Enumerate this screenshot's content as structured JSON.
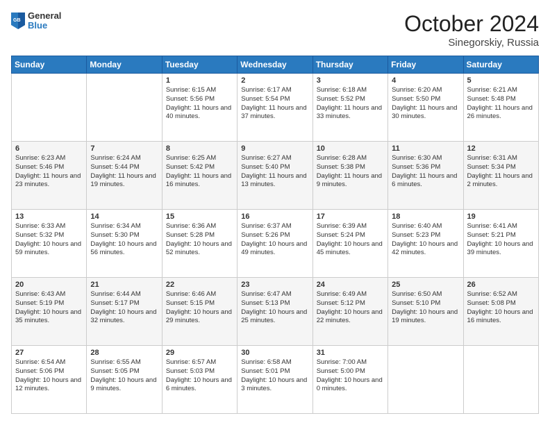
{
  "header": {
    "logo_line1": "General",
    "logo_line2": "Blue",
    "month": "October 2024",
    "location": "Sinegorskiy, Russia"
  },
  "days_of_week": [
    "Sunday",
    "Monday",
    "Tuesday",
    "Wednesday",
    "Thursday",
    "Friday",
    "Saturday"
  ],
  "weeks": [
    [
      {
        "day": "",
        "content": ""
      },
      {
        "day": "",
        "content": ""
      },
      {
        "day": "1",
        "content": "Sunrise: 6:15 AM\nSunset: 5:56 PM\nDaylight: 11 hours and 40 minutes."
      },
      {
        "day": "2",
        "content": "Sunrise: 6:17 AM\nSunset: 5:54 PM\nDaylight: 11 hours and 37 minutes."
      },
      {
        "day": "3",
        "content": "Sunrise: 6:18 AM\nSunset: 5:52 PM\nDaylight: 11 hours and 33 minutes."
      },
      {
        "day": "4",
        "content": "Sunrise: 6:20 AM\nSunset: 5:50 PM\nDaylight: 11 hours and 30 minutes."
      },
      {
        "day": "5",
        "content": "Sunrise: 6:21 AM\nSunset: 5:48 PM\nDaylight: 11 hours and 26 minutes."
      }
    ],
    [
      {
        "day": "6",
        "content": "Sunrise: 6:23 AM\nSunset: 5:46 PM\nDaylight: 11 hours and 23 minutes."
      },
      {
        "day": "7",
        "content": "Sunrise: 6:24 AM\nSunset: 5:44 PM\nDaylight: 11 hours and 19 minutes."
      },
      {
        "day": "8",
        "content": "Sunrise: 6:25 AM\nSunset: 5:42 PM\nDaylight: 11 hours and 16 minutes."
      },
      {
        "day": "9",
        "content": "Sunrise: 6:27 AM\nSunset: 5:40 PM\nDaylight: 11 hours and 13 minutes."
      },
      {
        "day": "10",
        "content": "Sunrise: 6:28 AM\nSunset: 5:38 PM\nDaylight: 11 hours and 9 minutes."
      },
      {
        "day": "11",
        "content": "Sunrise: 6:30 AM\nSunset: 5:36 PM\nDaylight: 11 hours and 6 minutes."
      },
      {
        "day": "12",
        "content": "Sunrise: 6:31 AM\nSunset: 5:34 PM\nDaylight: 11 hours and 2 minutes."
      }
    ],
    [
      {
        "day": "13",
        "content": "Sunrise: 6:33 AM\nSunset: 5:32 PM\nDaylight: 10 hours and 59 minutes."
      },
      {
        "day": "14",
        "content": "Sunrise: 6:34 AM\nSunset: 5:30 PM\nDaylight: 10 hours and 56 minutes."
      },
      {
        "day": "15",
        "content": "Sunrise: 6:36 AM\nSunset: 5:28 PM\nDaylight: 10 hours and 52 minutes."
      },
      {
        "day": "16",
        "content": "Sunrise: 6:37 AM\nSunset: 5:26 PM\nDaylight: 10 hours and 49 minutes."
      },
      {
        "day": "17",
        "content": "Sunrise: 6:39 AM\nSunset: 5:24 PM\nDaylight: 10 hours and 45 minutes."
      },
      {
        "day": "18",
        "content": "Sunrise: 6:40 AM\nSunset: 5:23 PM\nDaylight: 10 hours and 42 minutes."
      },
      {
        "day": "19",
        "content": "Sunrise: 6:41 AM\nSunset: 5:21 PM\nDaylight: 10 hours and 39 minutes."
      }
    ],
    [
      {
        "day": "20",
        "content": "Sunrise: 6:43 AM\nSunset: 5:19 PM\nDaylight: 10 hours and 35 minutes."
      },
      {
        "day": "21",
        "content": "Sunrise: 6:44 AM\nSunset: 5:17 PM\nDaylight: 10 hours and 32 minutes."
      },
      {
        "day": "22",
        "content": "Sunrise: 6:46 AM\nSunset: 5:15 PM\nDaylight: 10 hours and 29 minutes."
      },
      {
        "day": "23",
        "content": "Sunrise: 6:47 AM\nSunset: 5:13 PM\nDaylight: 10 hours and 25 minutes."
      },
      {
        "day": "24",
        "content": "Sunrise: 6:49 AM\nSunset: 5:12 PM\nDaylight: 10 hours and 22 minutes."
      },
      {
        "day": "25",
        "content": "Sunrise: 6:50 AM\nSunset: 5:10 PM\nDaylight: 10 hours and 19 minutes."
      },
      {
        "day": "26",
        "content": "Sunrise: 6:52 AM\nSunset: 5:08 PM\nDaylight: 10 hours and 16 minutes."
      }
    ],
    [
      {
        "day": "27",
        "content": "Sunrise: 6:54 AM\nSunset: 5:06 PM\nDaylight: 10 hours and 12 minutes."
      },
      {
        "day": "28",
        "content": "Sunrise: 6:55 AM\nSunset: 5:05 PM\nDaylight: 10 hours and 9 minutes."
      },
      {
        "day": "29",
        "content": "Sunrise: 6:57 AM\nSunset: 5:03 PM\nDaylight: 10 hours and 6 minutes."
      },
      {
        "day": "30",
        "content": "Sunrise: 6:58 AM\nSunset: 5:01 PM\nDaylight: 10 hours and 3 minutes."
      },
      {
        "day": "31",
        "content": "Sunrise: 7:00 AM\nSunset: 5:00 PM\nDaylight: 10 hours and 0 minutes."
      },
      {
        "day": "",
        "content": ""
      },
      {
        "day": "",
        "content": ""
      }
    ]
  ]
}
